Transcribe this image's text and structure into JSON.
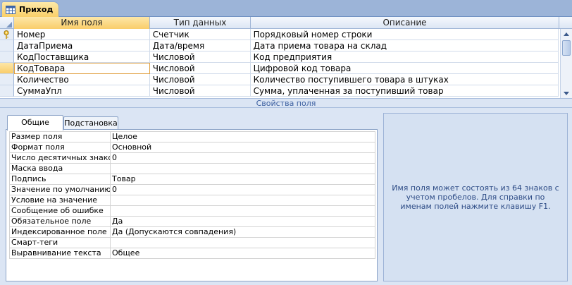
{
  "tab": {
    "label": "Приход",
    "icon": "table-icon"
  },
  "grid": {
    "columns": [
      "Имя поля",
      "Тип данных",
      "Описание"
    ],
    "rows": [
      {
        "name": "Номер",
        "type": "Счетчик",
        "desc": "Порядковый номер строки",
        "primary_key": true
      },
      {
        "name": "ДатаПриема",
        "type": "Дата/время",
        "desc": "Дата приема товара на склад"
      },
      {
        "name": "КодПоставщика",
        "type": "Числовой",
        "desc": "Код предприятия"
      },
      {
        "name": "КодТовара",
        "type": "Числовой",
        "desc": "Цифровой код товара",
        "current": true
      },
      {
        "name": "Количество",
        "type": "Числовой",
        "desc": "Количество поступившего товара в штуках"
      },
      {
        "name": "СуммаУпл",
        "type": "Числовой",
        "desc": "Сумма, уплаченная за поступивший товар"
      }
    ]
  },
  "section_title": "Свойства поля",
  "property_tabs": {
    "general": "Общие",
    "lookup": "Подстановка"
  },
  "properties": [
    {
      "label": "Размер поля",
      "value": "Целое"
    },
    {
      "label": "Формат поля",
      "value": "Основной"
    },
    {
      "label": "Число десятичных знаков",
      "value": "0"
    },
    {
      "label": "Маска ввода",
      "value": ""
    },
    {
      "label": "Подпись",
      "value": "Товар"
    },
    {
      "label": "Значение по умолчанию",
      "value": "0"
    },
    {
      "label": "Условие на значение",
      "value": ""
    },
    {
      "label": "Сообщение об ошибке",
      "value": ""
    },
    {
      "label": "Обязательное поле",
      "value": "Да"
    },
    {
      "label": "Индексированное поле",
      "value": "Да (Допускаются совпадения)"
    },
    {
      "label": "Смарт-теги",
      "value": ""
    },
    {
      "label": "Выравнивание текста",
      "value": "Общее"
    }
  ],
  "help_text": "Имя поля может состоять из 64 знаков с учетом пробелов.  Для справки по именам полей нажмите клавишу F1."
}
